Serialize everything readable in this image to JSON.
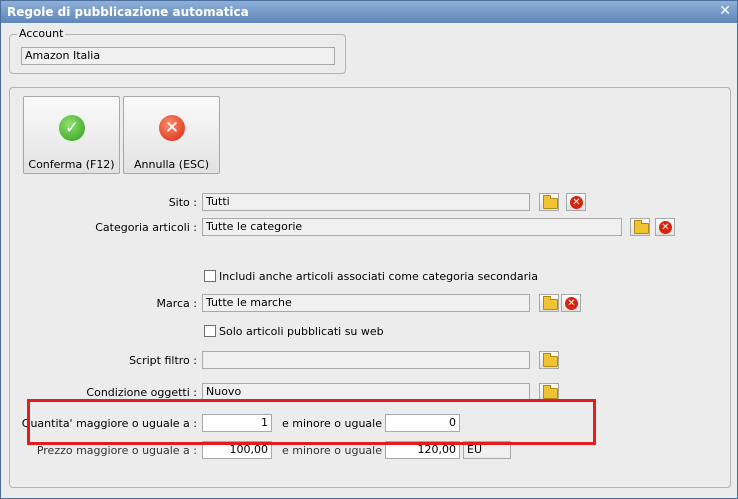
{
  "window": {
    "title": "Regole di pubblicazione automatica",
    "close_glyph": "✕"
  },
  "account": {
    "legend": "Account",
    "value": "Amazon Italia"
  },
  "toolbar": {
    "confirm_label": "Conferma (F12)",
    "cancel_label": "Annulla (ESC)",
    "confirm_icon": "check-icon",
    "cancel_icon": "x-icon",
    "confirm_glyph": "✓",
    "cancel_glyph": "✕"
  },
  "form": {
    "sito": {
      "label": "Sito :",
      "value": "Tutti"
    },
    "categoria": {
      "label": "Categoria articoli :",
      "value": "Tutte le categorie"
    },
    "includi": {
      "label": "Includi anche articoli associati come categoria secondaria",
      "checked": false
    },
    "marca": {
      "label": "Marca :",
      "value": "Tutte le marche"
    },
    "solo_web": {
      "label": "Solo articoli pubblicati su web",
      "checked": false
    },
    "script_filtro": {
      "label": "Script filtro :",
      "value": ""
    },
    "condizione": {
      "label": "Condizione oggetti :",
      "value": "Nuovo"
    },
    "quantita": {
      "label": "Quantita' maggiore o uguale a :",
      "min": "1",
      "between_label": "e minore o uguale a",
      "max": "0"
    },
    "prezzo": {
      "label": "Prezzo maggiore o uguale a :",
      "min": "100,00",
      "between_label": "e minore o uguale a",
      "max": "120,00",
      "currency": "EU"
    }
  },
  "icons": {
    "clear_glyph": "✕"
  },
  "colors": {
    "title_bar": "#5f86b9",
    "highlight": "#e11d1d",
    "confirm": "#2f9d1a",
    "cancel": "#d3250f",
    "folder": "#f1c232"
  }
}
